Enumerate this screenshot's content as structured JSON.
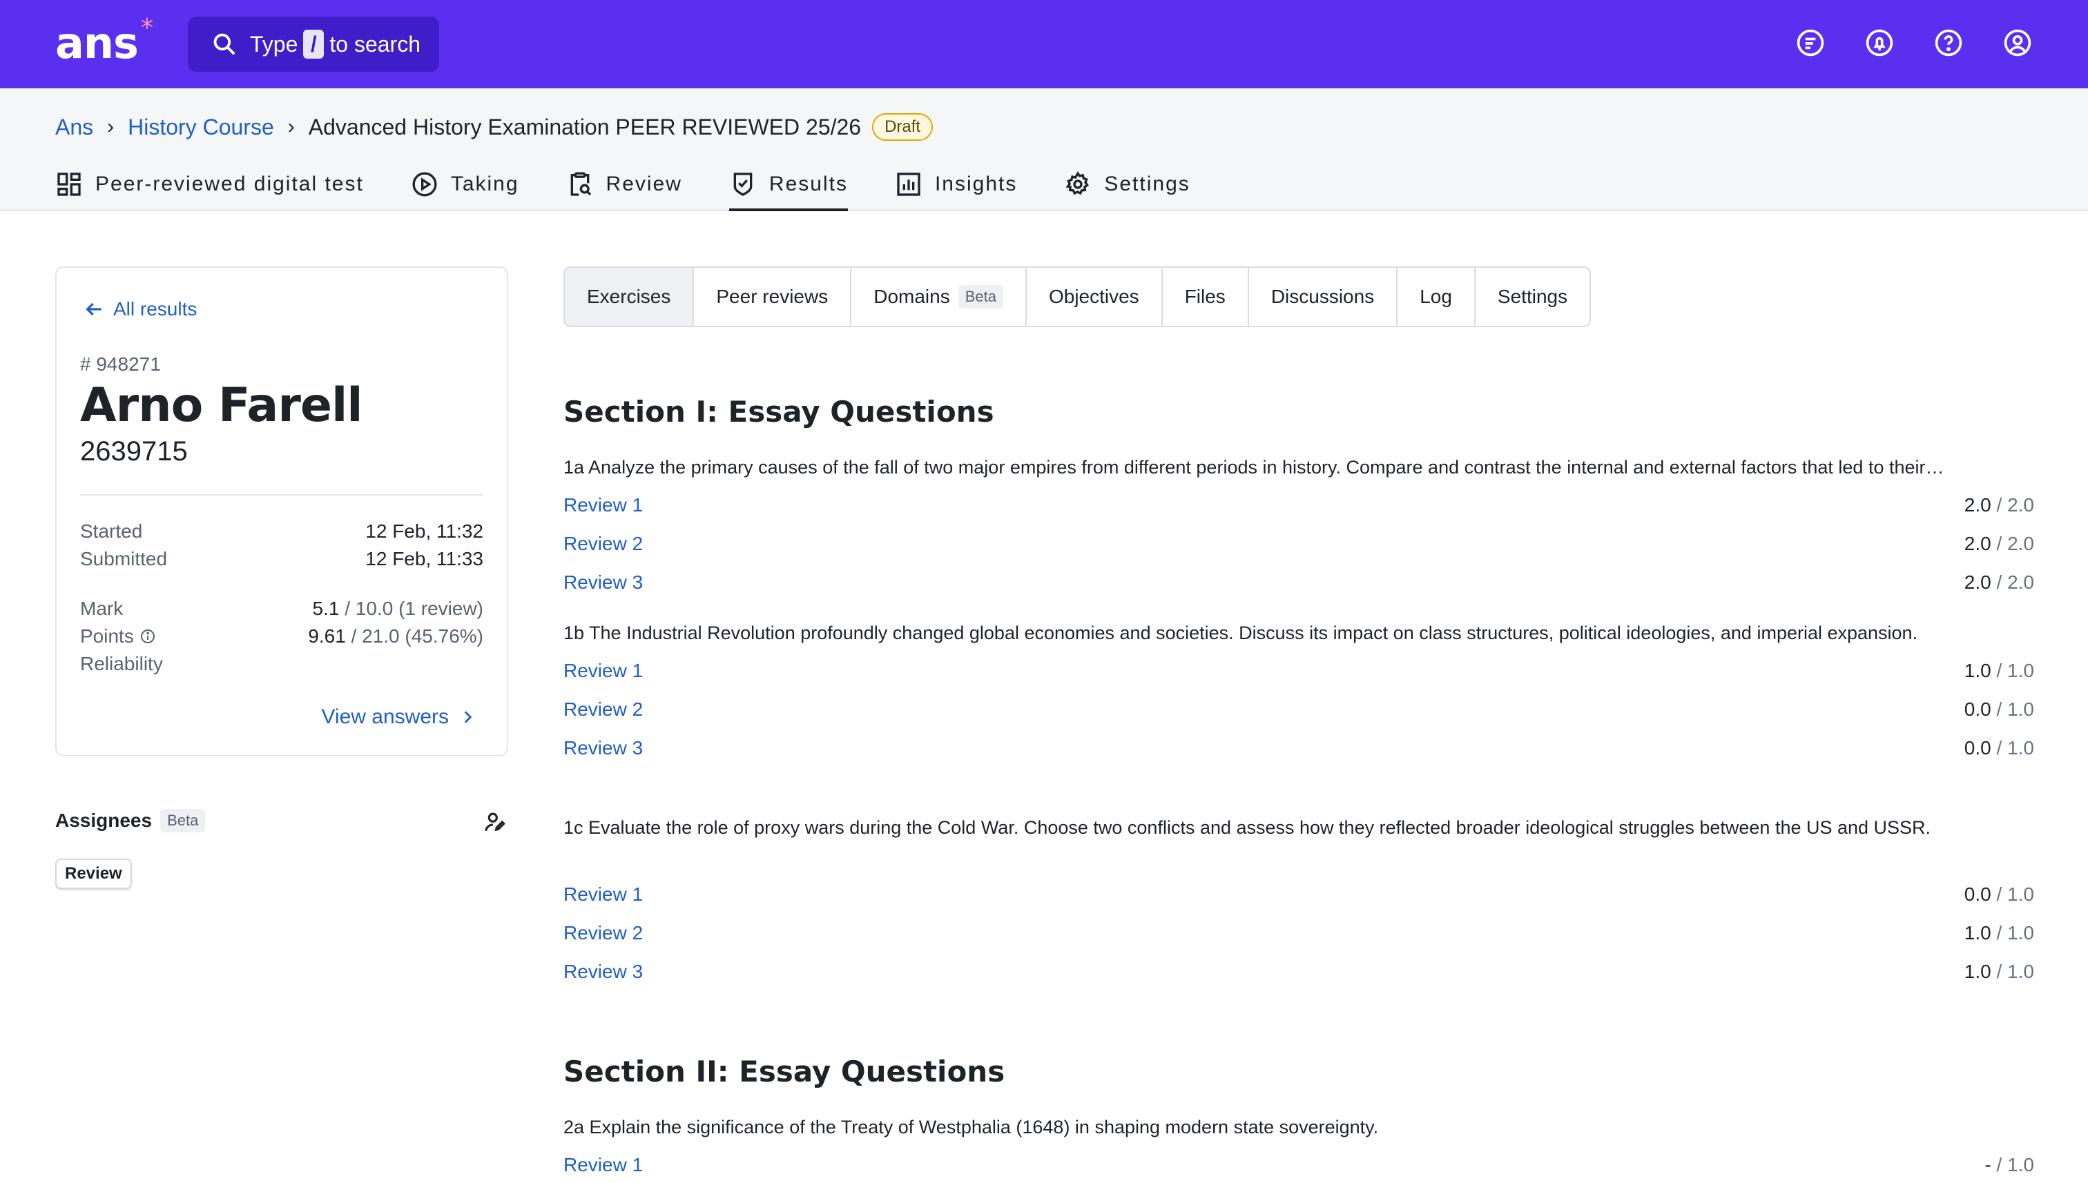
{
  "app": {
    "logo": "ans",
    "logo_mark": "*",
    "search": {
      "prefix": "Type",
      "key": "/",
      "suffix": "to search"
    },
    "top_icons": [
      "chat-icon",
      "bell-icon",
      "help-icon",
      "account-icon"
    ]
  },
  "breadcrumb": {
    "items": [
      "Ans",
      "History Course"
    ],
    "current": "Advanced History Examination PEER REVIEWED 25/26",
    "badge": "Draft"
  },
  "main_nav": [
    {
      "label": "Peer-reviewed digital test",
      "icon": "dashboard-icon"
    },
    {
      "label": "Taking",
      "icon": "play-icon"
    },
    {
      "label": "Review",
      "icon": "clipboard-search-icon"
    },
    {
      "label": "Results",
      "icon": "shield-check-icon",
      "active": true
    },
    {
      "label": "Insights",
      "icon": "bar-chart-icon"
    },
    {
      "label": "Settings",
      "icon": "gear-icon"
    }
  ],
  "student": {
    "back_label": "All results",
    "number": "# 948271",
    "name": "Arno Farell",
    "id": "2639715",
    "started_label": "Started",
    "started": "12 Feb, 11:32",
    "submitted_label": "Submitted",
    "submitted": "12 Feb, 11:33",
    "mark_label": "Mark",
    "mark_value": "5.1",
    "mark_rest": " / 10.0 (1 review)",
    "points_label": "Points",
    "points_value": "9.61",
    "points_rest": " / 21.0 (45.76%)",
    "reliability_label": "Reliability",
    "view_answers": "View answers"
  },
  "assignees": {
    "label": "Assignees",
    "badge": "Beta",
    "chip": "Review"
  },
  "tabs": [
    {
      "label": "Exercises",
      "active": true
    },
    {
      "label": "Peer reviews"
    },
    {
      "label": "Domains",
      "badge": "Beta"
    },
    {
      "label": "Objectives"
    },
    {
      "label": "Files"
    },
    {
      "label": "Discussions"
    },
    {
      "label": "Log"
    },
    {
      "label": "Settings"
    }
  ],
  "sections": [
    {
      "title": "Section I: Essay Questions",
      "questions": [
        {
          "text": "1a  Analyze the primary causes of the fall of two major empires from different periods in history. Compare and contrast the internal and external factors that led to their…",
          "reviews": [
            {
              "label": "Review 1",
              "score": "2.0",
              "max": " / 2.0"
            },
            {
              "label": "Review 2",
              "score": "2.0",
              "max": " / 2.0"
            },
            {
              "label": "Review 3",
              "score": "2.0",
              "max": " / 2.0"
            }
          ]
        },
        {
          "text": "1b  The Industrial Revolution profoundly changed global economies and societies. Discuss its impact on class structures, political ideologies, and imperial expansion.",
          "reviews": [
            {
              "label": "Review 1",
              "score": "1.0",
              "max": " / 1.0"
            },
            {
              "label": "Review 2",
              "score": "0.0",
              "max": " / 1.0"
            },
            {
              "label": "Review 3",
              "score": "0.0",
              "max": " / 1.0"
            }
          ]
        },
        {
          "text": "1c  Evaluate the role of proxy wars during the Cold War. Choose two conflicts and assess how they reflected broader ideological struggles between the US and USSR.",
          "reviews": [
            {
              "label": "Review 1",
              "score": "0.0",
              "max": " / 1.0"
            },
            {
              "label": "Review 2",
              "score": "1.0",
              "max": " / 1.0"
            },
            {
              "label": "Review 3",
              "score": "1.0",
              "max": " / 1.0"
            }
          ]
        }
      ]
    },
    {
      "title": "Section II: Essay Questions",
      "questions": [
        {
          "text": "2a  Explain the significance of the Treaty of Westphalia (1648) in shaping modern state sovereignty.",
          "reviews": [
            {
              "label": "Review 1",
              "score": "-",
              "max": " / 1.0"
            }
          ]
        }
      ]
    }
  ]
}
